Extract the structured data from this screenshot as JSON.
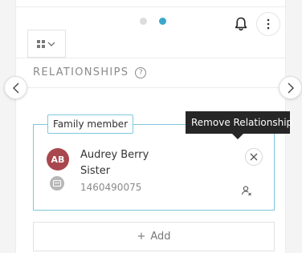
{
  "pager": {
    "active_index": 1,
    "total": 2
  },
  "header": {
    "notifications_icon": "bell-icon",
    "more_icon": "vertical-dots-icon",
    "view_icon": "grid-view-icon"
  },
  "relationships": {
    "title": "RELATIONSHIPS",
    "help_glyph": "?",
    "card": {
      "tag": "Family member",
      "avatar_initials": "AB",
      "avatar_color": "#a9474e",
      "name": "Audrey Berry",
      "relation": "Sister",
      "id_number": "1460490075"
    },
    "tooltip": "Remove Relationship",
    "add_label": "Add",
    "add_glyph": "+"
  },
  "colors": {
    "accent": "#3aa7c9",
    "card_border": "#7fc7dd",
    "tooltip_bg": "#262626"
  }
}
